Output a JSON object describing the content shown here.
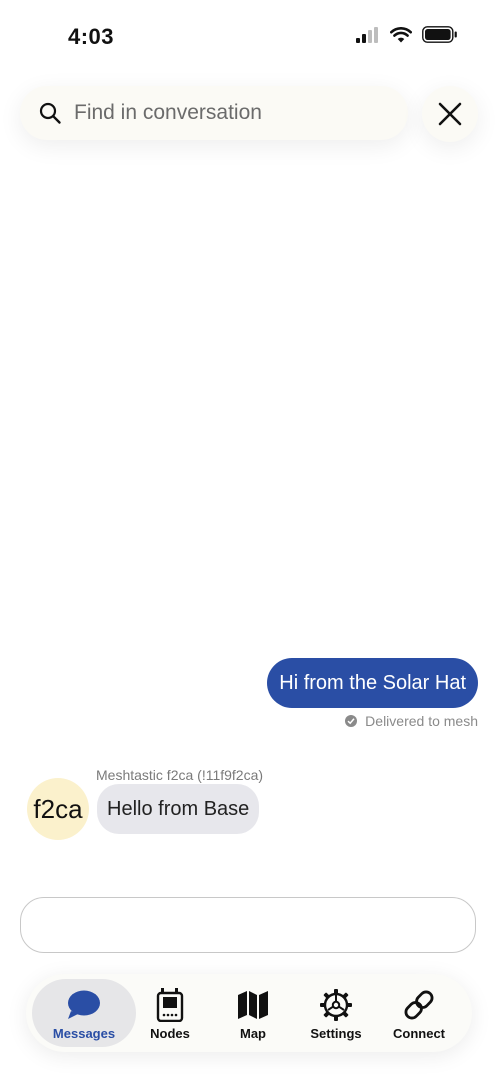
{
  "status_bar": {
    "time": "4:03"
  },
  "search": {
    "placeholder": "Find in conversation"
  },
  "messages": [
    {
      "direction": "outgoing",
      "text": "Hi from the Solar Hat",
      "status": "Delivered to mesh"
    },
    {
      "direction": "incoming",
      "sender": "Meshtastic f2ca (!11f9f2ca)",
      "avatar": "f2ca",
      "text": "Hello from Base"
    }
  ],
  "composer": {
    "value": ""
  },
  "tabs": [
    {
      "label": "Messages",
      "icon": "chat-bubble-icon",
      "active": true
    },
    {
      "label": "Nodes",
      "icon": "radio-device-icon",
      "active": false
    },
    {
      "label": "Map",
      "icon": "map-icon",
      "active": false
    },
    {
      "label": "Settings",
      "icon": "gear-icon",
      "active": false
    },
    {
      "label": "Connect",
      "icon": "link-icon",
      "active": false
    }
  ],
  "colors": {
    "accent": "#2a4ea5",
    "avatar_bg": "#fbf1cc",
    "incoming_bubble": "#e7e7ec"
  }
}
